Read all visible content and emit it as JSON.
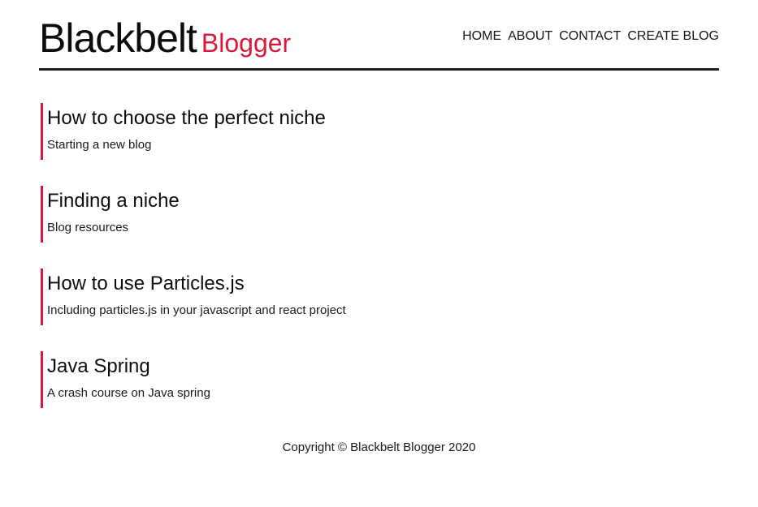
{
  "header": {
    "brand_main": "Blackbelt",
    "brand_accent": "Blogger",
    "nav": [
      {
        "label": "HOME"
      },
      {
        "label": "ABOUT"
      },
      {
        "label": "CONTACT"
      },
      {
        "label": "CREATE BLOG"
      }
    ]
  },
  "posts": [
    {
      "title": "How to choose the perfect niche",
      "subtitle": "Starting a new blog"
    },
    {
      "title": "Finding a niche",
      "subtitle": "Blog resources"
    },
    {
      "title": "How to use Particles.js",
      "subtitle": "Including particles.js in your javascript and react project"
    },
    {
      "title": "Java Spring",
      "subtitle": "A crash course on Java spring"
    }
  ],
  "footer": {
    "copyright": "Copyright © Blackbelt Blogger 2020"
  },
  "colors": {
    "accent": "#d7193b",
    "text": "#111111",
    "rule": "#202020"
  }
}
